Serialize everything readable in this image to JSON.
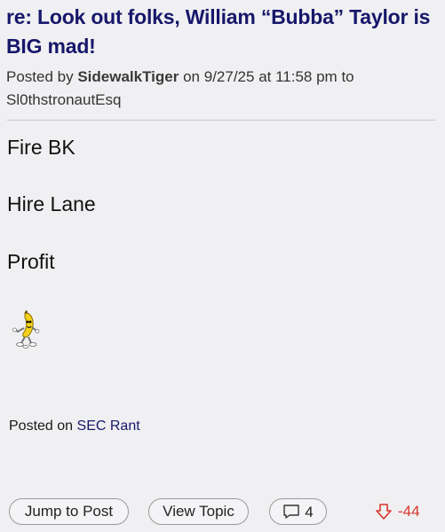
{
  "post": {
    "title": "re: Look out folks, William “Bubba” Taylor is BIG mad!",
    "meta": {
      "posted_by_label": "Posted by",
      "author": "SidewalkTiger",
      "on_label": "on",
      "timestamp": "9/27/25 at 11:58 pm",
      "to_label": "to",
      "recipient": "Sl0thstronautEsq"
    },
    "body": {
      "lines": [
        "Fire BK",
        "Hire Lane",
        "Profit"
      ],
      "emoji": "dancing-banana-icon"
    },
    "posted_on_label": "Posted on",
    "board": "SEC Rant"
  },
  "actions": {
    "jump_label": "Jump to Post",
    "view_label": "View Topic",
    "reply_count": "4",
    "vote_score": "-44",
    "vote_icon": "thumbs-down-icon",
    "reply_icon": "comment-icon"
  },
  "colors": {
    "title": "#17176b",
    "downvote": "#d9342b",
    "background": "#f0f0f2"
  }
}
